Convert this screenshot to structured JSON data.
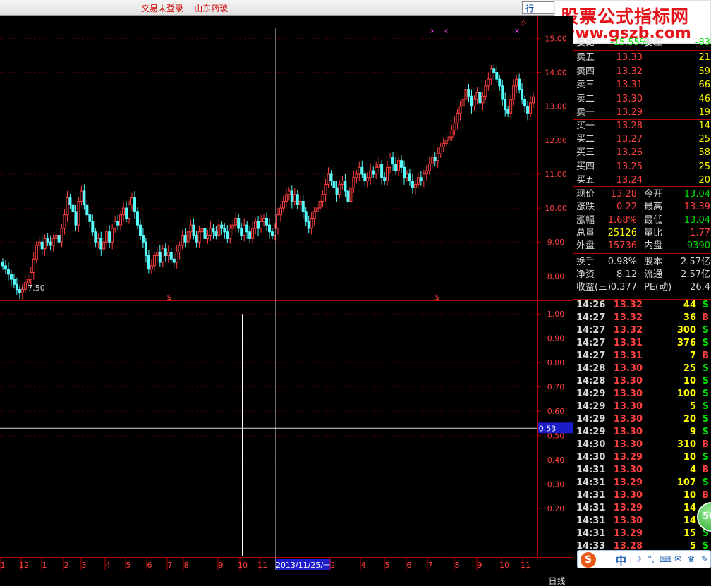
{
  "top_bar": {
    "status": "交易未登录    山东药玻",
    "quote_tab": "行 情"
  },
  "watermark": {
    "line1": "股票公式指标网",
    "line2": "www.gszb.com"
  },
  "price_axis": [
    "15.00",
    "14.00",
    "13.00",
    "12.00",
    "11.00",
    "10.00",
    "9.00",
    "8.00"
  ],
  "min_label": "←7.50",
  "indicator_axis": [
    "1.00",
    "0.90",
    "0.80",
    "0.70",
    "0.60",
    "0.50",
    "0.40",
    "0.30",
    "0.20"
  ],
  "indicator_value": "0.53",
  "time_axis": {
    "labels": [
      "1",
      "12",
      "1",
      "2",
      "3",
      "4",
      "5",
      "6",
      "7",
      "8",
      "9",
      "10",
      "11",
      "2013/11/25/一",
      "2",
      "4",
      "5",
      "6",
      "7",
      "8",
      "9",
      "10",
      "11"
    ],
    "period": "日线"
  },
  "signal_marks": [
    "$",
    "$"
  ],
  "top_marks": [
    "×",
    "×",
    "×",
    "◇"
  ],
  "order_book": {
    "header_partial": [
      "委比",
      "-15.55%",
      "委差",
      "-83"
    ],
    "sells": [
      {
        "label": "卖五",
        "price": "13.33",
        "vol": "21"
      },
      {
        "label": "卖四",
        "price": "13.32",
        "vol": "59"
      },
      {
        "label": "卖三",
        "price": "13.31",
        "vol": "66"
      },
      {
        "label": "卖二",
        "price": "13.30",
        "vol": "46"
      },
      {
        "label": "卖一",
        "price": "13.29",
        "vol": "19"
      }
    ],
    "buys": [
      {
        "label": "买一",
        "price": "13.28",
        "vol": "14"
      },
      {
        "label": "买二",
        "price": "13.27",
        "vol": "25"
      },
      {
        "label": "买三",
        "price": "13.26",
        "vol": "58"
      },
      {
        "label": "买四",
        "price": "13.25",
        "vol": "25"
      },
      {
        "label": "买五",
        "price": "13.24",
        "vol": "20"
      }
    ]
  },
  "stats": [
    {
      "l1": "现价",
      "v1": "13.28",
      "l2": "今开",
      "v2": "13.04",
      "c2": "#00e000"
    },
    {
      "l1": "涨跌",
      "v1": "0.22",
      "l2": "最高",
      "v2": "13.39",
      "c2": "#ff4040"
    },
    {
      "l1": "涨幅",
      "v1": "1.68%",
      "l2": "最低",
      "v2": "13.04",
      "c2": "#00e000"
    },
    {
      "l1": "总量",
      "v1": "25126",
      "l2": "量比",
      "v2": "1.77",
      "c2": "#ff4040",
      "c1": "#ffff00"
    },
    {
      "l1": "外盘",
      "v1": "15736",
      "l2": "内盘",
      "v2": "9390",
      "c2": "#00e000"
    },
    {
      "l1": "换手",
      "v1": "0.98%",
      "l2": "股本",
      "v2": "2.57亿",
      "c1": "#d8d8d8",
      "c2": "#d8d8d8"
    },
    {
      "l1": "净资",
      "v1": "8.12",
      "l2": "流通",
      "v2": "2.57亿",
      "c1": "#d8d8d8",
      "c2": "#d8d8d8"
    },
    {
      "l1": "收益(三)",
      "v1": "0.377",
      "l2": "PE(动)",
      "v2": "26.4",
      "c1": "#d8d8d8",
      "c2": "#d8d8d8"
    }
  ],
  "ticks": [
    {
      "time": "14:26",
      "price": "13.32",
      "vol": "44",
      "side": "S"
    },
    {
      "time": "14:27",
      "price": "13.32",
      "vol": "36",
      "side": "B"
    },
    {
      "time": "14:27",
      "price": "13.32",
      "vol": "300",
      "side": "S"
    },
    {
      "time": "14:27",
      "price": "13.31",
      "vol": "376",
      "side": "S"
    },
    {
      "time": "14:27",
      "price": "13.31",
      "vol": "7",
      "side": "B"
    },
    {
      "time": "14:28",
      "price": "13.30",
      "vol": "25",
      "side": "S"
    },
    {
      "time": "14:28",
      "price": "13.30",
      "vol": "10",
      "side": "S"
    },
    {
      "time": "14:29",
      "price": "13.30",
      "vol": "100",
      "side": "S"
    },
    {
      "time": "14:29",
      "price": "13.30",
      "vol": "5",
      "side": "S"
    },
    {
      "time": "14:29",
      "price": "13.30",
      "vol": "20",
      "side": "S"
    },
    {
      "time": "14:29",
      "price": "13.30",
      "vol": "9",
      "side": "S"
    },
    {
      "time": "14:30",
      "price": "13.30",
      "vol": "310",
      "side": "B"
    },
    {
      "time": "14:30",
      "price": "13.29",
      "vol": "10",
      "side": "S"
    },
    {
      "time": "14:31",
      "price": "13.30",
      "vol": "4",
      "side": "B"
    },
    {
      "time": "14:31",
      "price": "13.29",
      "vol": "107",
      "side": "S"
    },
    {
      "time": "14:31",
      "price": "13.30",
      "vol": "10",
      "side": "B"
    },
    {
      "time": "14:31",
      "price": "13.29",
      "vol": "14",
      "side": ""
    },
    {
      "time": "14:31",
      "price": "13.30",
      "vol": "14",
      "side": ""
    },
    {
      "time": "14:31",
      "price": "13.29",
      "vol": "15",
      "side": "S"
    },
    {
      "time": "14:33",
      "price": "13.28",
      "vol": "5",
      "side": "S"
    },
    {
      "time": "14:33",
      "price": "13.28",
      "vol": "20",
      "side": "S"
    }
  ],
  "zoom": {
    "plus": "+",
    "minus": "-",
    "zero": "0"
  },
  "ime": {
    "logo": "S",
    "mode": "中",
    "icons": [
      "☽",
      "°,",
      "⌨",
      "✉",
      "♛",
      "✎"
    ]
  },
  "green_badge": "50",
  "colors": {
    "up": "#ff4040",
    "down": "#54fcfc",
    "buy": "#ff4040",
    "sell": "#00e000",
    "axis": "#b00000"
  },
  "chart_data": {
    "type": "candlestick",
    "price_range": [
      7.3,
      15.3
    ],
    "indicator_range": [
      0,
      1.05
    ],
    "indicator_spikes": [
      {
        "index": 109,
        "value": 1.0
      }
    ],
    "closes": [
      8.3,
      8.2,
      8.05,
      7.9,
      7.75,
      7.6,
      7.5,
      7.6,
      7.8,
      7.9,
      8.1,
      8.5,
      8.9,
      9.0,
      8.8,
      9.1,
      9.0,
      8.9,
      9.1,
      9.2,
      9.0,
      9.4,
      9.8,
      10.3,
      10.1,
      9.9,
      9.5,
      10.2,
      10.5,
      10.1,
      9.8,
      9.6,
      9.3,
      9.0,
      9.1,
      8.8,
      9.0,
      9.3,
      9.0,
      9.4,
      9.6,
      9.5,
      9.8,
      10.0,
      9.7,
      10.1,
      10.3,
      9.9,
      9.5,
      9.2,
      9.0,
      8.6,
      8.2,
      8.3,
      8.6,
      8.7,
      8.4,
      8.8,
      8.6,
      8.7,
      8.5,
      8.4,
      8.7,
      8.9,
      9.2,
      9.0,
      9.3,
      9.5,
      9.2,
      9.0,
      9.3,
      9.4,
      9.1,
      9.2,
      9.4,
      9.3,
      9.2,
      9.5,
      9.4,
      9.3,
      9.1,
      9.4,
      9.5,
      9.7,
      9.4,
      9.2,
      9.5,
      9.3,
      9.1,
      9.4,
      9.6,
      9.4,
      9.6,
      9.7,
      9.5,
      9.3,
      9.2,
      9.4,
      9.8,
      10.0,
      10.2,
      10.4,
      10.5,
      10.2,
      10.4,
      10.1,
      10.2,
      9.9,
      9.6,
      9.4,
      9.7,
      9.9,
      10.0,
      10.2,
      10.4,
      10.7,
      11.0,
      10.8,
      10.6,
      10.4,
      10.7,
      10.8,
      10.5,
      10.2,
      10.6,
      10.9,
      11.0,
      11.2,
      11.0,
      10.8,
      10.9,
      11.1,
      11.0,
      11.2,
      11.3,
      10.9,
      10.8,
      11.2,
      11.5,
      11.3,
      11.1,
      11.4,
      11.2,
      10.9,
      11.0,
      10.8,
      10.6,
      10.7,
      10.9,
      10.8,
      11.0,
      11.1,
      11.3,
      11.5,
      11.4,
      11.6,
      11.8,
      11.9,
      12.0,
      12.1,
      12.3,
      12.5,
      12.8,
      13.0,
      13.2,
      13.5,
      13.3,
      13.0,
      13.2,
      13.4,
      13.1,
      13.3,
      13.6,
      13.8,
      14.1,
      14.0,
      13.8,
      13.6,
      13.2,
      12.9,
      12.8,
      13.2,
      13.6,
      13.8,
      13.5,
      13.2,
      13.0,
      12.8,
      13.1,
      13.28
    ]
  }
}
